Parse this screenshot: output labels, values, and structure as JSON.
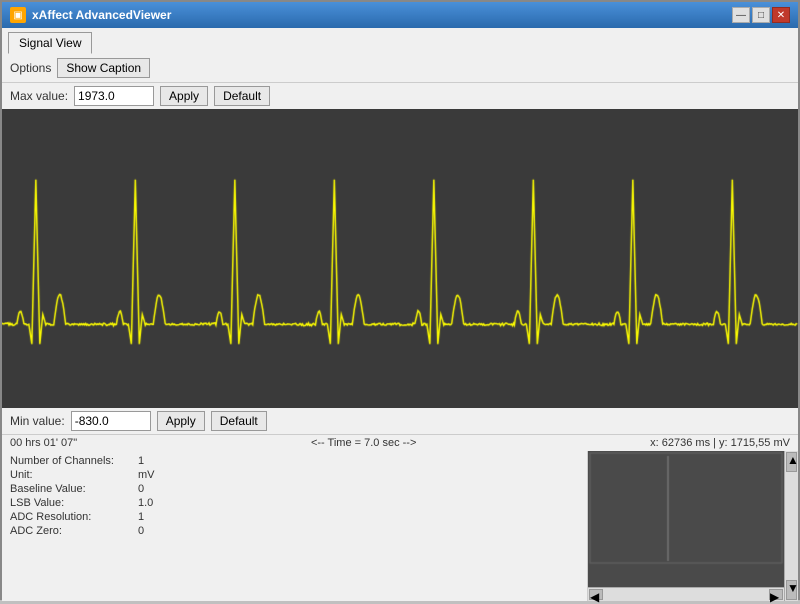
{
  "window": {
    "title": "xAffect AdvancedViewer",
    "icon": "▣"
  },
  "title_controls": {
    "minimize": "—",
    "maximize": "□",
    "close": "✕"
  },
  "tabs": [
    {
      "label": "Signal View",
      "active": true
    }
  ],
  "options": {
    "label": "Options",
    "show_caption_label": "Show Caption"
  },
  "max_value_bar": {
    "label": "Max value:",
    "value": "1973.0",
    "apply_label": "Apply",
    "default_label": "Default"
  },
  "min_value_bar": {
    "label": "Min value:",
    "value": "-830.0",
    "apply_label": "Apply",
    "default_label": "Default"
  },
  "status": {
    "time_elapsed": "00 hrs 01' 07\"",
    "time_marker": "<-- Time = 7.0 sec -->",
    "coordinates": "x: 62736 ms | y: 1715,55 mV"
  },
  "info": {
    "rows": [
      {
        "key": "Number of Channels:",
        "value": "1"
      },
      {
        "key": "Unit:",
        "value": "mV"
      },
      {
        "key": "Baseline Value:",
        "value": "0"
      },
      {
        "key": "LSB Value:",
        "value": "1.0"
      },
      {
        "key": "ADC Resolution:",
        "value": "1"
      },
      {
        "key": "ADC Zero:",
        "value": "0"
      }
    ]
  },
  "signal": {
    "color": "#ffff00",
    "background": "#3a3a3a"
  }
}
